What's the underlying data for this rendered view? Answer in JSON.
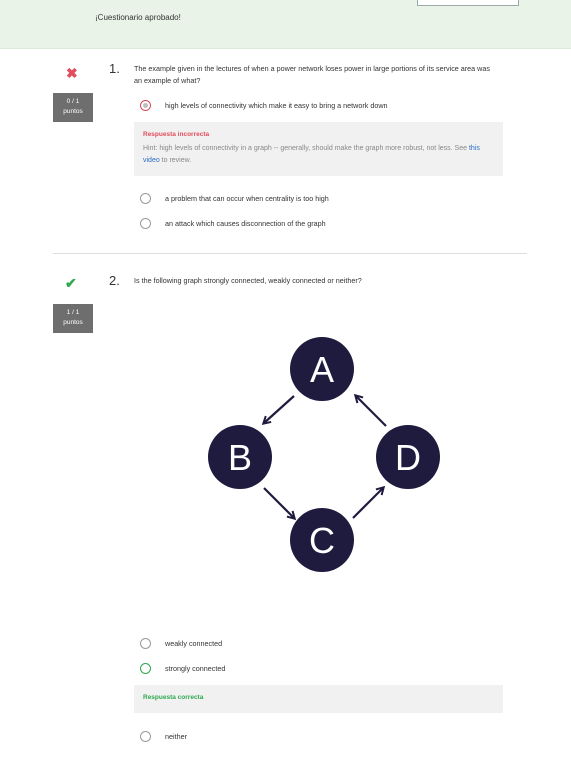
{
  "banner": {
    "text": "¡Cuestionario aprobado!"
  },
  "questions": [
    {
      "number": "1.",
      "text": "The example given in the lectures of when a power network loses power in large portions of its service area was an example of what?",
      "score": "0 / 1",
      "score_label": "puntos",
      "options": [
        "high levels of connectivity which make it easy to bring a network down",
        "a problem that can occur when centrality is too high",
        "an attack which causes disconnection of the graph"
      ],
      "feedback": {
        "title": "Respuesta incorrecta",
        "hint_before": "Hint: high levels of connectivity in a graph -- generally, should make the graph more robust, not less. See ",
        "hint_link": "this video",
        "hint_after": " to review."
      }
    },
    {
      "number": "2.",
      "text": "Is the following graph strongly connected, weakly connected or neither?",
      "score": "1 / 1",
      "score_label": "puntos",
      "graph_nodes": [
        "A",
        "B",
        "C",
        "D"
      ],
      "options": [
        "weakly connected",
        "strongly connected",
        "neither"
      ],
      "feedback": {
        "title": "Respuesta correcta"
      }
    }
  ],
  "colors": {
    "wrong": "#e04d5b",
    "correct": "#2fa84f",
    "node_fill": "#1e1b3f",
    "link": "#2b6cc4"
  }
}
